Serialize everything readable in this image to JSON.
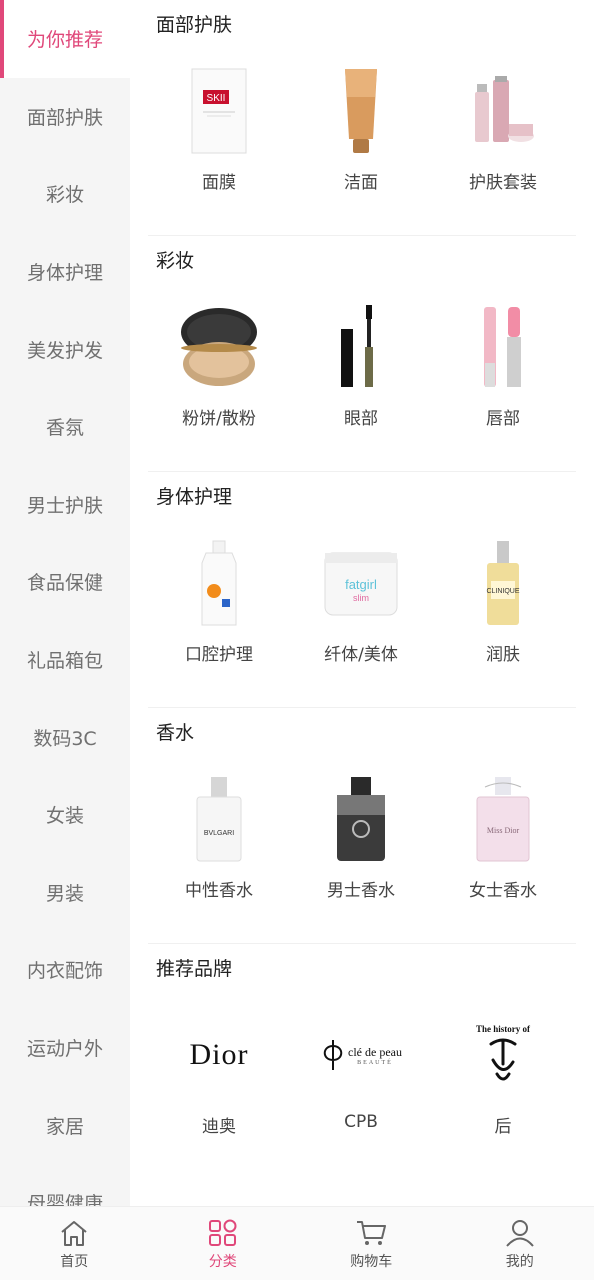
{
  "sidebar": {
    "items": [
      {
        "label": "为你推荐",
        "active": true
      },
      {
        "label": "面部护肤"
      },
      {
        "label": "彩妆"
      },
      {
        "label": "身体护理"
      },
      {
        "label": "美发护发"
      },
      {
        "label": "香氛"
      },
      {
        "label": "男士护肤"
      },
      {
        "label": "食品保健"
      },
      {
        "label": "礼品箱包"
      },
      {
        "label": "数码3C"
      },
      {
        "label": "女装"
      },
      {
        "label": "男装"
      },
      {
        "label": "内衣配饰"
      },
      {
        "label": "运动户外"
      },
      {
        "label": "家居"
      },
      {
        "label": "母婴健康"
      }
    ]
  },
  "sections": [
    {
      "title": "面部护肤",
      "items": [
        {
          "label": "面膜",
          "icon": "face-mask-icon"
        },
        {
          "label": "洁面",
          "icon": "cleanser-tube-icon"
        },
        {
          "label": "护肤套装",
          "icon": "skincare-set-icon"
        }
      ]
    },
    {
      "title": "彩妆",
      "items": [
        {
          "label": "粉饼/散粉",
          "icon": "powder-compact-icon"
        },
        {
          "label": "眼部",
          "icon": "mascara-icon"
        },
        {
          "label": "唇部",
          "icon": "lip-gloss-icon"
        }
      ]
    },
    {
      "title": "身体护理",
      "items": [
        {
          "label": "口腔护理",
          "icon": "mouthwash-bottle-icon"
        },
        {
          "label": "纤体/美体",
          "icon": "body-cream-jar-icon"
        },
        {
          "label": "润肤",
          "icon": "moisturizer-bottle-icon"
        }
      ]
    },
    {
      "title": "香水",
      "items": [
        {
          "label": "中性香水",
          "icon": "unisex-perfume-icon"
        },
        {
          "label": "男士香水",
          "icon": "mens-perfume-icon"
        },
        {
          "label": "女士香水",
          "icon": "womens-perfume-icon"
        }
      ]
    },
    {
      "title": "推荐品牌",
      "items": [
        {
          "label": "迪奥",
          "icon": "dior-logo",
          "logo_text": "Dior"
        },
        {
          "label": "CPB",
          "icon": "cpb-logo",
          "logo_text": "clé de peau",
          "logo_sub": "BEAUTÉ"
        },
        {
          "label": "后",
          "icon": "whoo-logo",
          "logo_text": "The history of"
        }
      ]
    }
  ],
  "tabbar": {
    "tabs": [
      {
        "label": "首页",
        "icon": "home-icon"
      },
      {
        "label": "分类",
        "icon": "category-icon",
        "active": true
      },
      {
        "label": "购物车",
        "icon": "cart-icon"
      },
      {
        "label": "我的",
        "icon": "user-icon"
      }
    ]
  },
  "colors": {
    "accent": "#e0487a",
    "sidebar_bg": "#f5f5f5"
  }
}
